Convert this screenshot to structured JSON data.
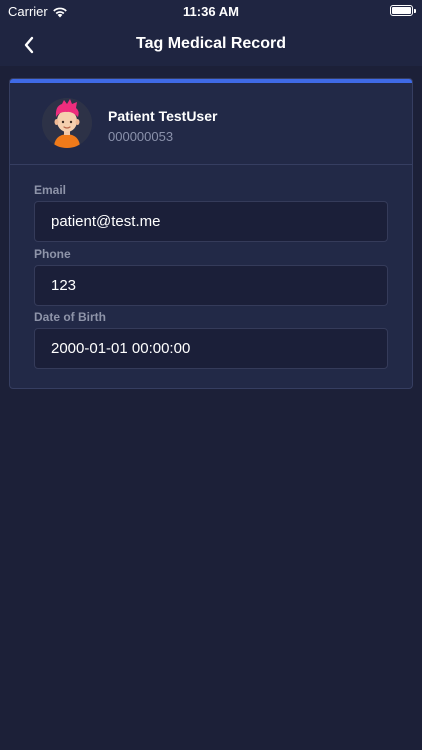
{
  "status_bar": {
    "carrier": "Carrier",
    "time": "11:36 AM"
  },
  "nav": {
    "title": "Tag Medical Record"
  },
  "patient": {
    "name": "Patient TestUser",
    "id": "000000053"
  },
  "fields": [
    {
      "label": "Email",
      "value": "patient@test.me"
    },
    {
      "label": "Phone",
      "value": "123"
    },
    {
      "label": "Date of Birth",
      "value": "2000-01-01 00:00:00"
    }
  ],
  "colors": {
    "background": "#1c2038",
    "accent": "#3f6ae6",
    "card": "#222947"
  }
}
